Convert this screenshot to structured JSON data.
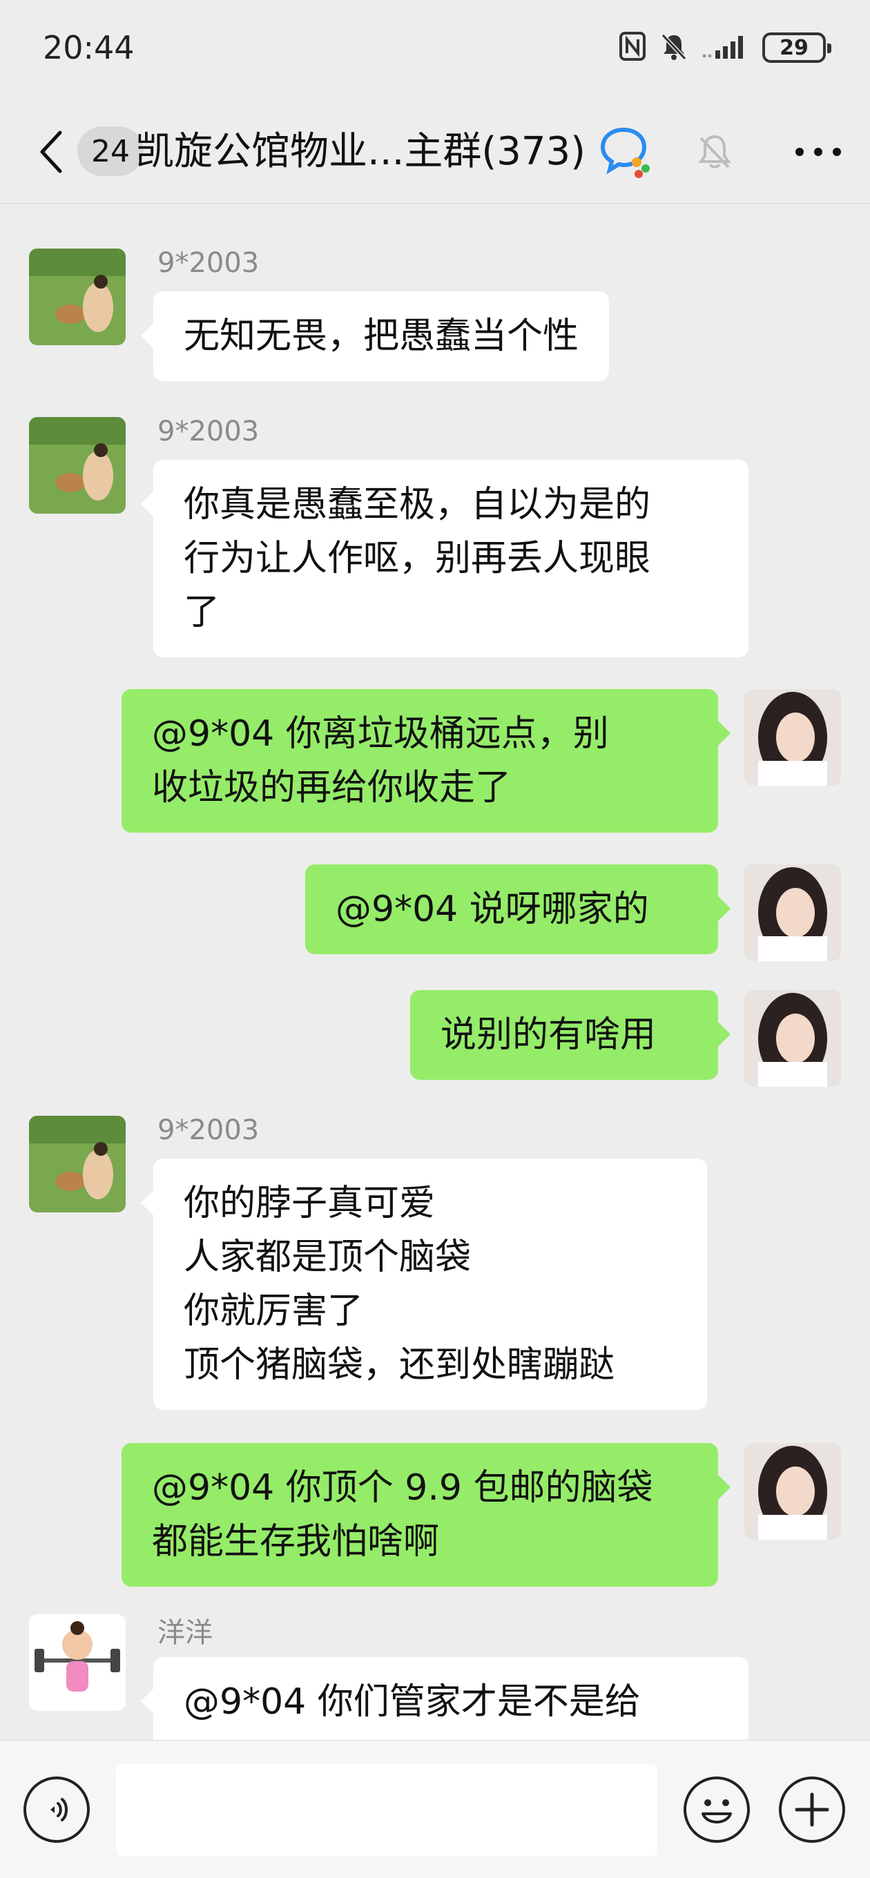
{
  "status_bar": {
    "time": "20:44",
    "battery": "29"
  },
  "header": {
    "unread_count": "24",
    "title": "凯旋公馆物业...主群(373)"
  },
  "messages": [
    {
      "side": "left",
      "sender": "9*2003",
      "text": "无知无畏，把愚蠢当个性",
      "avatar": "deer-landscape-avatar"
    },
    {
      "side": "left",
      "sender": "9*2003",
      "text": "你真是愚蠢至极，自以为是的\n行为让人作呕，别再丢人现眼\n了",
      "avatar": "deer-landscape-avatar"
    },
    {
      "side": "right",
      "text": "@9*04 你离垃圾桶远点，别\n收垃圾的再给你收走了",
      "avatar": "woman-portrait-avatar"
    },
    {
      "side": "right",
      "text": "@9*04 说呀哪家的",
      "avatar": "woman-portrait-avatar"
    },
    {
      "side": "right",
      "text": "说别的有啥用",
      "avatar": "woman-portrait-avatar"
    },
    {
      "side": "left",
      "sender": "9*2003",
      "text": "你的脖子真可爱\n人家都是顶个脑袋\n你就厉害了\n顶个猪脑袋，还到处瞎蹦跶",
      "avatar": "deer-landscape-avatar"
    },
    {
      "side": "right",
      "text": "@9*04 你顶个 9.9 包邮的脑袋\n都能生存我怕啥啊",
      "avatar": "woman-portrait-avatar"
    },
    {
      "side": "left",
      "sender": "洋洋",
      "text": "@9*04 你们管家才是不是给",
      "avatar": "weightlifter-cartoon-avatar"
    }
  ],
  "input_bar": {
    "placeholder": ""
  },
  "colors": {
    "background": "#ededed",
    "incoming_bubble": "#ffffff",
    "outgoing_bubble": "#95ec69",
    "sender_name": "#8a8a8a"
  },
  "icons": [
    "back-icon",
    "chat-bubble-icon",
    "mute-bell-icon",
    "more-icon",
    "voice-icon",
    "emoji-icon",
    "plus-icon",
    "nfc-icon",
    "silent-icon",
    "signal-icon",
    "battery-icon"
  ]
}
